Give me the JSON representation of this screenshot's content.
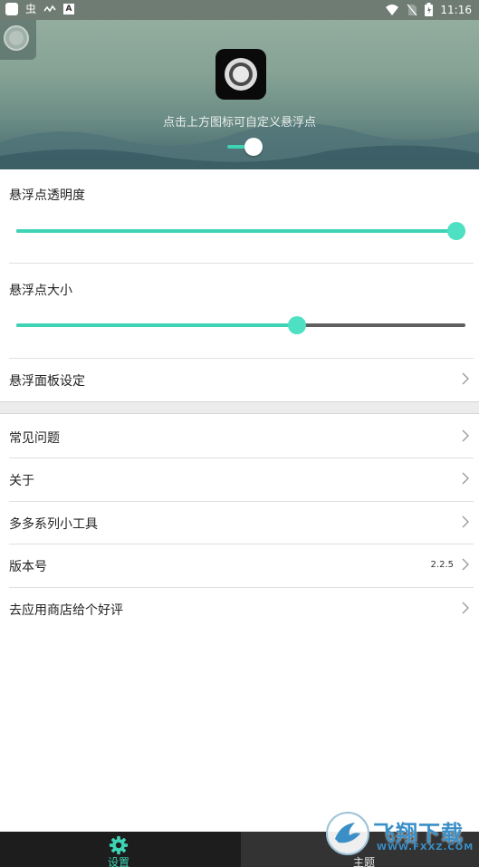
{
  "status_bar": {
    "glyph_1": "虫",
    "glyph_2": "A",
    "time": "11:16"
  },
  "header": {
    "hint": "点击上方图标可自定义悬浮点",
    "toggle_on": true,
    "accent_color": "#3fd3b5"
  },
  "settings": {
    "opacity_label": "悬浮点透明度",
    "opacity_value_fraction": 1.0,
    "size_label": "悬浮点大小",
    "size_value_fraction": 0.625,
    "panel_label": "悬浮面板设定"
  },
  "menu": {
    "items": [
      {
        "label": "常见问题",
        "value": ""
      },
      {
        "label": "关于",
        "value": ""
      },
      {
        "label": "多多系列小工具",
        "value": ""
      },
      {
        "label": "版本号",
        "value": "2.2.5"
      },
      {
        "label": "去应用商店给个好评",
        "value": ""
      }
    ]
  },
  "bottom_nav": {
    "tabs": [
      {
        "label": "设置",
        "icon": "gear-icon",
        "active": true
      },
      {
        "label": "主题",
        "icon": "",
        "active": false
      }
    ]
  },
  "watermark": {
    "title": "飞翔下载",
    "url": "WWW.FXXZ.COM"
  }
}
